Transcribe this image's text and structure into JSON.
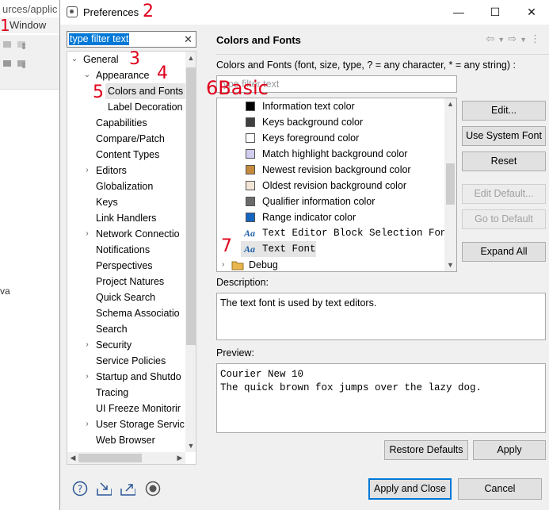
{
  "background": {
    "path_text": "urces/applic",
    "menu_window": "Window",
    "side_text": "va"
  },
  "window": {
    "title": "Preferences",
    "minimize": "—",
    "maximize": "☐",
    "close": "✕"
  },
  "filter": {
    "value": "type filter text",
    "clear": "✕"
  },
  "tree": {
    "general": "General",
    "appearance": "Appearance",
    "colors_and_fonts": "Colors and Fonts",
    "label_decorations": "Label Decoration",
    "items": [
      "Capabilities",
      "Compare/Patch",
      "Content Types",
      "Editors",
      "Globalization",
      "Keys",
      "Link Handlers",
      "Network Connectio",
      "Notifications",
      "Perspectives",
      "Project Natures",
      "Quick Search",
      "Schema Associatio",
      "Search",
      "Security",
      "Service Policies",
      "Startup and Shutdo",
      "Tracing",
      "UI Freeze Monitorir",
      "User Storage Servic",
      "Web Browser"
    ]
  },
  "page": {
    "title": "Colors and Fonts",
    "list_label": "Colors and Fonts (font, size, type, ? = any character, * = any string) :",
    "filter_placeholder": "type filter text",
    "rows": [
      {
        "label": "Information text color",
        "swatch": "#000000"
      },
      {
        "label": "Keys background color",
        "swatch": "#3f3f3f"
      },
      {
        "label": "Keys foreground color",
        "swatch": "#ffffff"
      },
      {
        "label": "Match highlight background color",
        "swatch": "#d0cdf0"
      },
      {
        "label": "Newest revision background color",
        "swatch": "#c48a3c"
      },
      {
        "label": "Oldest revision background color",
        "swatch": "#f2e4d7"
      },
      {
        "label": "Qualifier information color",
        "swatch": "#6a6a6a"
      },
      {
        "label": "Range indicator color",
        "swatch": "#1565c0"
      }
    ],
    "font_rows": [
      "Text Editor Block Selection Font",
      "Text Font"
    ],
    "font_icon": "Aa",
    "debug": "Debug",
    "buttons": {
      "edit": "Edit...",
      "use_system_font": "Use System Font",
      "reset": "Reset",
      "edit_default": "Edit Default...",
      "go_to_default": "Go to Default",
      "expand_all": "Expand All"
    },
    "description_label": "Description:",
    "description": "The text font is used by text editors.",
    "preview_label": "Preview:",
    "preview_line1": "Courier New 10",
    "preview_line2": "The quick brown fox jumps over the lazy dog.",
    "restore_defaults": "Restore Defaults",
    "apply": "Apply"
  },
  "footer": {
    "apply_and_close": "Apply and Close",
    "cancel": "Cancel"
  },
  "annotations": [
    "1",
    "2",
    "3",
    "4",
    "5",
    "6Basic",
    "7"
  ],
  "accent_color": "#0078d7"
}
